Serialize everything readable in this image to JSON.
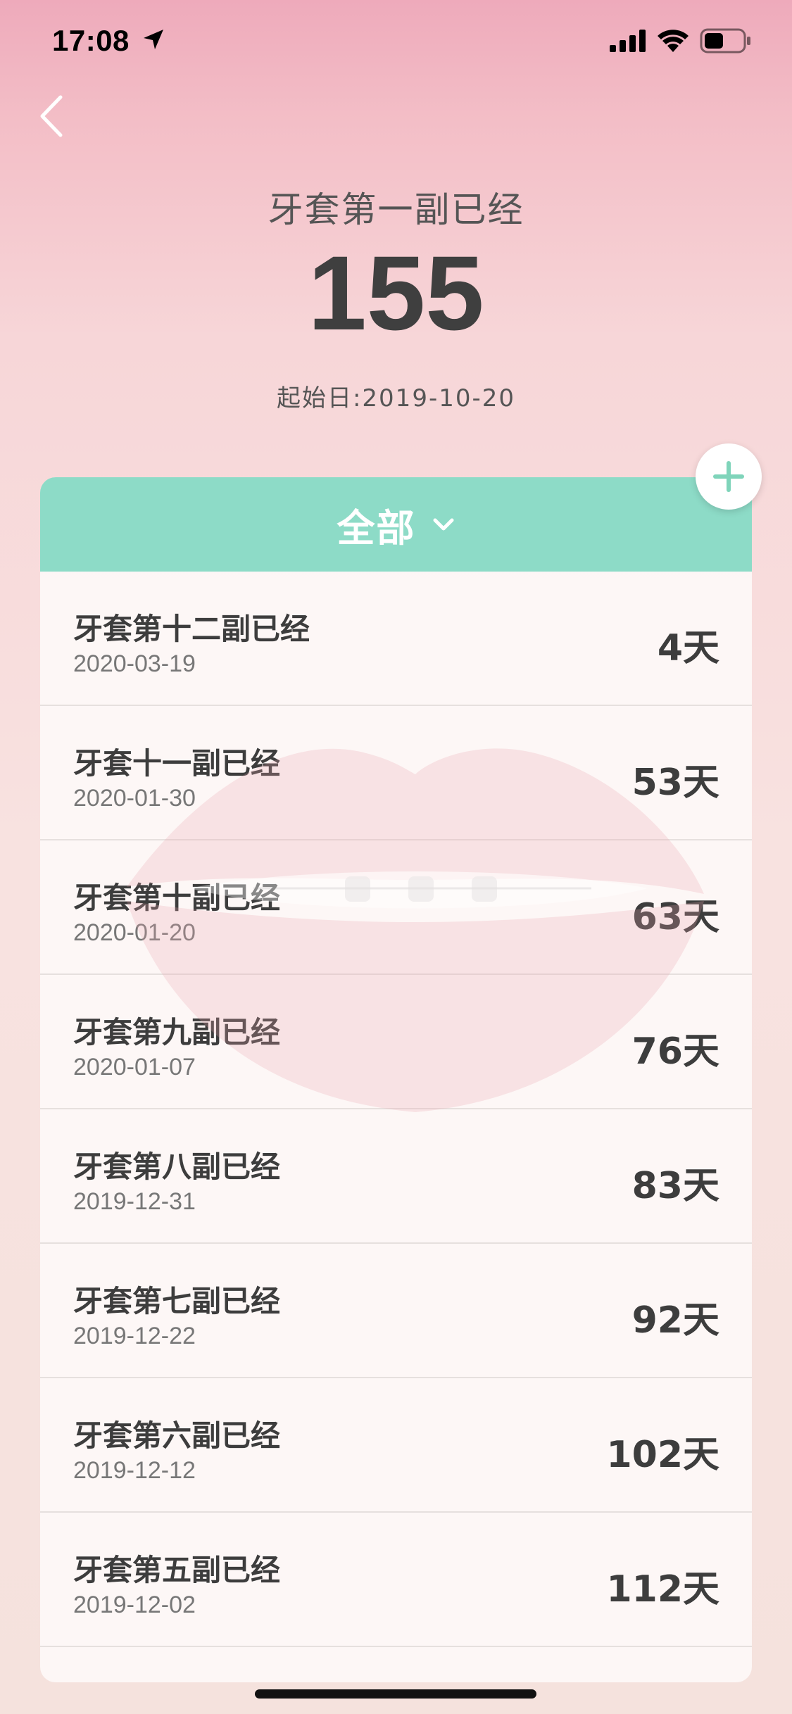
{
  "status_bar": {
    "time": "17:08"
  },
  "header": {
    "title": "牙套第一副已经",
    "count": "155",
    "start_date": "起始日:2019-10-20"
  },
  "filter": {
    "label": "全部"
  },
  "items": [
    {
      "title": "牙套第十二副已经",
      "date": "2020-03-19",
      "days": "4天"
    },
    {
      "title": "牙套十一副已经",
      "date": "2020-01-30",
      "days": "53天"
    },
    {
      "title": "牙套第十副已经",
      "date": "2020-01-20",
      "days": "63天"
    },
    {
      "title": "牙套第九副已经",
      "date": "2020-01-07",
      "days": "76天"
    },
    {
      "title": "牙套第八副已经",
      "date": "2019-12-31",
      "days": "83天"
    },
    {
      "title": "牙套第七副已经",
      "date": "2019-12-22",
      "days": "92天"
    },
    {
      "title": "牙套第六副已经",
      "date": "2019-12-12",
      "days": "102天"
    },
    {
      "title": "牙套第五副已经",
      "date": "2019-12-02",
      "days": "112天"
    }
  ],
  "icons": {
    "back": "back-arrow-icon",
    "add": "plus-icon",
    "dropdown": "chevron-down-icon"
  },
  "colors": {
    "accent_green": "#8ddbc7",
    "background_pink": "#f3bdc6",
    "text_dark": "#3d3d3d"
  }
}
